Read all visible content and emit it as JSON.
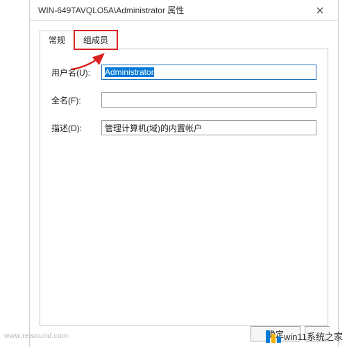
{
  "window": {
    "title": "WIN-649TAVQLO5A\\Administrator 属性"
  },
  "tabs": {
    "general": "常规",
    "member": "组成员"
  },
  "form": {
    "username_label": "用户名(U):",
    "username_value": "Administrator",
    "fullname_label": "全名(F):",
    "fullname_value": "",
    "description_label": "描述(D):",
    "description_value": "管理计算机(域)的内置帐户"
  },
  "buttons": {
    "ok": "确定"
  },
  "watermarks": {
    "left": "www.reisound.com",
    "right": "win11系统之家"
  }
}
